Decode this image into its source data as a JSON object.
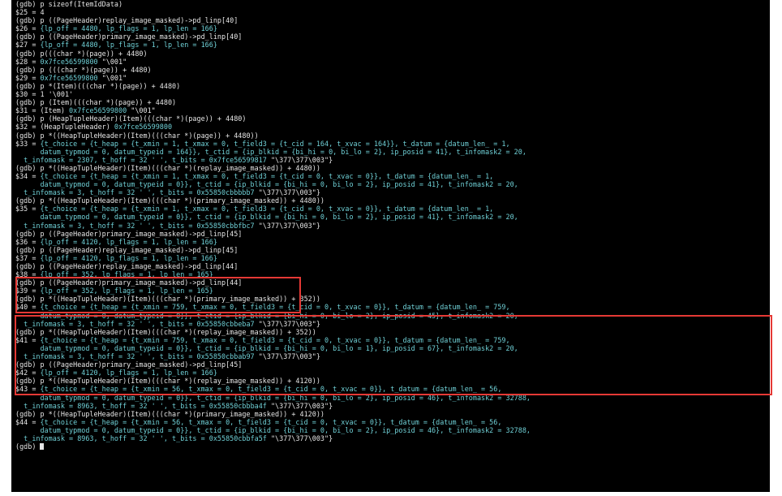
{
  "lines": [
    [
      {
        "t": "(gdb) p sizeof(ItemIdData)"
      }
    ],
    [
      {
        "t": "$25 = 4"
      }
    ],
    [
      {
        "t": "(gdb) p ((PageHeader)replay_image_masked)->pd_linp[40]"
      }
    ],
    [
      {
        "t": "$26 = "
      },
      {
        "t": "{lp_off = 4480, lp_flags = 1, lp_len = 166}",
        "c": 1
      }
    ],
    [
      {
        "t": "(gdb) p ((PageHeader)primary_image_masked)->pd_linp[40]"
      }
    ],
    [
      {
        "t": "$27 = "
      },
      {
        "t": "{lp_off = 4480, lp_flags = 1, lp_len = 166}",
        "c": 1
      }
    ],
    [
      {
        "t": "(gdb) p(((char *)(page)) + 4480)"
      }
    ],
    [
      {
        "t": "$28 = "
      },
      {
        "t": "0x7fce56599800",
        "c": 1
      },
      {
        "t": " \"\\001\""
      }
    ],
    [
      {
        "t": "(gdb) p (((char *)(page)) + 4480)"
      }
    ],
    [
      {
        "t": "$29 = "
      },
      {
        "t": "0x7fce56599800",
        "c": 1
      },
      {
        "t": " \"\\001\""
      }
    ],
    [
      {
        "t": "(gdb) p *(Item)(((char *)(page)) + 4480)"
      }
    ],
    [
      {
        "t": "$30 = 1 '\\001'"
      }
    ],
    [
      {
        "t": "(gdb) p (Item)(((char *)(page)) + 4480)"
      }
    ],
    [
      {
        "t": "$31 = (Item) "
      },
      {
        "t": "0x7fce56599800",
        "c": 1
      },
      {
        "t": " \"\\001\""
      }
    ],
    [
      {
        "t": "(gdb) p (HeapTupleHeader)(Item)(((char *)(page)) + 4480)"
      }
    ],
    [
      {
        "t": "$32 = (HeapTupleHeader) "
      },
      {
        "t": "0x7fce56599800",
        "c": 1
      }
    ],
    [
      {
        "t": "(gdb) p *((HeapTupleHeader)(Item)(((char *)(page)) + 4480))"
      }
    ],
    [
      {
        "t": "$33 = "
      },
      {
        "t": "{t_choice = {t_heap = {t_xmin = 1, t_xmax = 0, t_field3 = {t_cid = 164, t_xvac = 164}}, t_datum = {datum_len_ = 1,",
        "c": 1
      }
    ],
    [
      {
        "t": "      datum_typmod = 0, datum_typeid = 164}}, t_ctid = {ip_blkid = {bi_hi = 0, bi_lo = 2}, ip_posid = 41}, t_infomask2 = 20,",
        "c": 1
      }
    ],
    [
      {
        "t": "  t_infomask = 2307, t_hoff = 32 ' ', t_bits = ",
        "c": 1
      },
      {
        "t": "0x7fce56599817",
        "c": 1
      },
      {
        "t": " \"\\377\\377\\003\"}"
      }
    ],
    [
      {
        "t": "(gdb) p *((HeapTupleHeader)(Item)(((char *)(replay_image_masked)) + 4480))"
      }
    ],
    [
      {
        "t": "$34 = "
      },
      {
        "t": "{t_choice = {t_heap = {t_xmin = 1, t_xmax = 0, t_field3 = {t_cid = 0, t_xvac = 0}}, t_datum = {datum_len_ = 1,",
        "c": 1
      }
    ],
    [
      {
        "t": "      datum_typmod = 0, datum_typeid = 0}}, t_ctid = {ip_blkid = {bi_hi = 0, bi_lo = 2}, ip_posid = 41}, t_infomask2 = 20,",
        "c": 1
      }
    ],
    [
      {
        "t": "  t_infomask = 3, t_hoff = 32 ' ', t_bits = ",
        "c": 1
      },
      {
        "t": "0x55850cbbbbb7",
        "c": 1
      },
      {
        "t": " \"\\377\\377\\003\"}"
      }
    ],
    [
      {
        "t": "(gdb) p *((HeapTupleHeader)(Item)(((char *)(primary_image_masked)) + 4480))"
      }
    ],
    [
      {
        "t": "$35 = "
      },
      {
        "t": "{t_choice = {t_heap = {t_xmin = 1, t_xmax = 0, t_field3 = {t_cid = 0, t_xvac = 0}}, t_datum = {datum_len_ = 1,",
        "c": 1
      }
    ],
    [
      {
        "t": "      datum_typmod = 0, datum_typeid = 0}}, t_ctid = {ip_blkid = {bi_hi = 0, bi_lo = 2}, ip_posid = 41}, t_infomask2 = 20,",
        "c": 1
      }
    ],
    [
      {
        "t": "  t_infomask = 3, t_hoff = 32 ' ', t_bits = ",
        "c": 1
      },
      {
        "t": "0x55850cbbfbc7",
        "c": 1
      },
      {
        "t": " \"\\377\\377\\003\"}"
      }
    ],
    [
      {
        "t": "(gdb) p ((PageHeader)primary_image_masked)->pd_linp[45]"
      }
    ],
    [
      {
        "t": "$36 = "
      },
      {
        "t": "{lp_off = 4120, lp_flags = 1, lp_len = 166}",
        "c": 1
      }
    ],
    [
      {
        "t": "(gdb) p ((PageHeader)replay_image_masked)->pd_linp[45]"
      }
    ],
    [
      {
        "t": "$37 = "
      },
      {
        "t": "{lp_off = 4120, lp_flags = 1, lp_len = 166}",
        "c": 1
      }
    ],
    [
      {
        "t": "(gdb) p ((PageHeader)replay_image_masked)->pd_linp[44]"
      }
    ],
    [
      {
        "t": "$38 = "
      },
      {
        "t": "{lp_off = 352, lp_flags = 1, lp_len = 165}",
        "c": 1
      }
    ],
    [
      {
        "t": "(gdb) p ((PageHeader)primary_image_masked)->pd_linp[44]"
      }
    ],
    [
      {
        "t": "$39 = "
      },
      {
        "t": "{lp_off = 352, lp_flags = 1, lp_len = 165}",
        "c": 1
      }
    ],
    [
      {
        "t": "(gdb) p *((HeapTupleHeader)(Item)(((char *)(primary_image_masked)) + 352))"
      }
    ],
    [
      {
        "t": "$40 = "
      },
      {
        "t": "{t_choice = {t_heap = {t_xmin = 759, t_xmax = 0, t_field3 = {t_cid = 0, t_xvac = 0}}, t_datum = {datum_len_ = 759,",
        "c": 1
      }
    ],
    [
      {
        "t": "      datum_typmod = 0, datum_typeid = 0}}, t_ctid = {ip_blkid = {bi_hi = 0, bi_lo = 2}, ip_posid = 45}, t_infomask2 = 20,",
        "c": 1
      }
    ],
    [
      {
        "t": "  t_infomask = 3, t_hoff = 32 ' ', t_bits = ",
        "c": 1
      },
      {
        "t": "0x55850cbbeba7",
        "c": 1
      },
      {
        "t": " \"\\377\\377\\003\"}"
      }
    ],
    [
      {
        "t": "(gdb) p *((HeapTupleHeader)(Item)(((char *)(replay_image_masked)) + 352))"
      }
    ],
    [
      {
        "t": "$41 = "
      },
      {
        "t": "{t_choice = {t_heap = {t_xmin = 759, t_xmax = 0, t_field3 = {t_cid = 0, t_xvac = 0}}, t_datum = {datum_len_ = 759,",
        "c": 1
      }
    ],
    [
      {
        "t": "      datum_typmod = 0, datum_typeid = 0}}, t_ctid = {ip_blkid = {bi_hi = 0, bi_lo = 1}, ip_posid = 67}, t_infomask2 = 20,",
        "c": 1
      }
    ],
    [
      {
        "t": "  t_infomask = 3, t_hoff = 32 ' ', t_bits = ",
        "c": 1
      },
      {
        "t": "0x55850cbbab97",
        "c": 1
      },
      {
        "t": " \"\\377\\377\\003\"}"
      }
    ],
    [
      {
        "t": "(gdb) p ((PageHeader)primary_image_masked)->pd_linp[45]"
      }
    ],
    [
      {
        "t": "$42 = "
      },
      {
        "t": "{lp_off = 4120, lp_flags = 1, lp_len = 166}",
        "c": 1
      }
    ],
    [
      {
        "t": "(gdb) p *((HeapTupleHeader)(Item)(((char *)(replay_image_masked)) + 4120))"
      }
    ],
    [
      {
        "t": "$43 = "
      },
      {
        "t": "{t_choice = {t_heap = {t_xmin = 56, t_xmax = 0, t_field3 = {t_cid = 0, t_xvac = 0}}, t_datum = {datum_len_ = 56,",
        "c": 1
      }
    ],
    [
      {
        "t": "      datum_typmod = 0, datum_typeid = 0}}, t_ctid = {ip_blkid = {bi_hi = 0, bi_lo = 2}, ip_posid = 46}, t_infomask2 = 32788,",
        "c": 1
      }
    ],
    [
      {
        "t": "  t_infomask = 8963, t_hoff = 32 ' ', t_bits = ",
        "c": 1
      },
      {
        "t": "0x55850cbbba4f",
        "c": 1
      },
      {
        "t": " \"\\377\\377\\003\"}"
      }
    ],
    [
      {
        "t": "(gdb) p *((HeapTupleHeader)(Item)(((char *)(primary_image_masked)) + 4120))"
      }
    ],
    [
      {
        "t": "$44 = "
      },
      {
        "t": "{t_choice = {t_heap = {t_xmin = 56, t_xmax = 0, t_field3 = {t_cid = 0, t_xvac = 0}}, t_datum = {datum_len_ = 56,",
        "c": 1
      }
    ],
    [
      {
        "t": "      datum_typmod = 0, datum_typeid = 0}}, t_ctid = {ip_blkid = {bi_hi = 0, bi_lo = 2}, ip_posid = 46}, t_infomask2 = 32788,",
        "c": 1
      }
    ],
    [
      {
        "t": "  t_infomask = 8963, t_hoff = 32 ' ', t_bits = ",
        "c": 1
      },
      {
        "t": "0x55850cbbfa5f",
        "c": 1
      },
      {
        "t": " \"\\377\\377\\003\"}"
      }
    ]
  ],
  "prompt": "(gdb) ",
  "colors": {
    "background": "#000000",
    "text": "#e6e6e6",
    "value": "#6fd0d6",
    "highlight": "#e53935"
  }
}
